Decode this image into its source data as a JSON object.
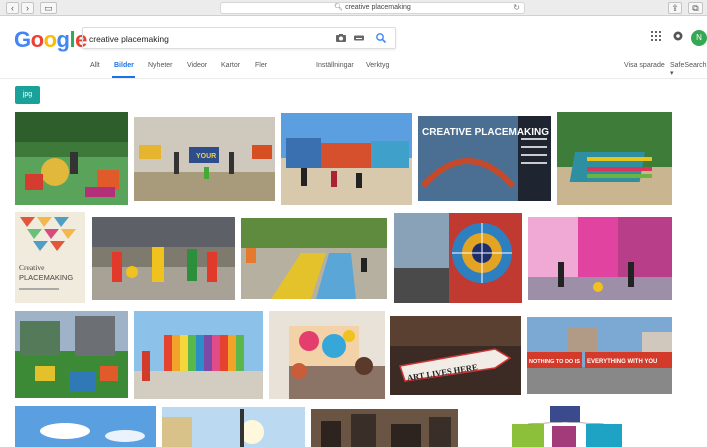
{
  "browser": {
    "url_text": "creative placemaking"
  },
  "google": {
    "logo_letters": [
      "G",
      "o",
      "o",
      "g",
      "l",
      "e"
    ],
    "logo_colors": [
      "#4285f4",
      "#ea4335",
      "#fbbc05",
      "#4285f4",
      "#34a853",
      "#ea4335"
    ],
    "search_value": "creative placemaking",
    "avatar_initial": "N",
    "avatar_color": "#34a853"
  },
  "tabs": {
    "all": "Allt",
    "images": "Bilder",
    "news": "Nyheter",
    "videos": "Videor",
    "maps": "Kartor",
    "more": "Fler",
    "settings": "Inställningar",
    "tools": "Verktyg",
    "saved": "Visa sparade",
    "safesearch": "SafeSearch ▾"
  },
  "filter_chip": "jpg",
  "accent_color": "#1a73e8",
  "chip_color": "#1aa19a",
  "image_banners": {
    "creative_placemaking_title": "CREATIVE PLACEMAKING",
    "book_title_1": "Creative",
    "book_title_2": "PLACEMAKING",
    "art_lives_here": "ART LIVES HERE",
    "mural_left": "NOTHING TO DO IS",
    "mural_right": "EVERYTHING WITH YOU",
    "your_sign": "YOUR"
  }
}
